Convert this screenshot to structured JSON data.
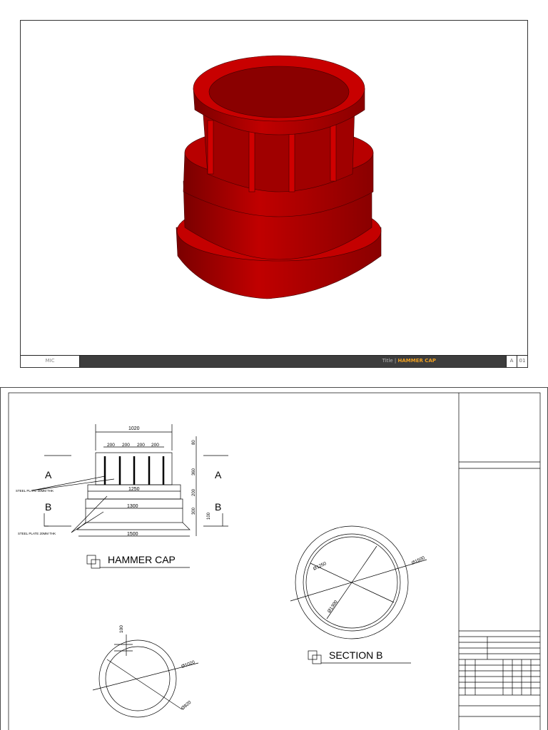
{
  "title_bar": {
    "left": "MIC",
    "title_label": "Title",
    "title": "HAMMER CAP",
    "rev": "A",
    "sheet": "01"
  },
  "elevation": {
    "dims_top": "1020",
    "dims_spacing": [
      "200",
      "200",
      "200",
      "200"
    ],
    "dim_1250": "1250",
    "dim_1300": "1300",
    "dim_1500": "1500",
    "dims_right": [
      "80",
      "360",
      "200",
      "300",
      "100"
    ],
    "section_a": "A",
    "section_b": "B",
    "note_30": "STEEL PLATE 30MM THK",
    "note_20": "STEEL PLATE 20MM THK",
    "caption": "HAMMER CAP"
  },
  "section_b": {
    "d1250": "Ø1250",
    "d1300": "Ø1300",
    "d1500": "Ø1500",
    "caption": "SECTION B"
  },
  "section_a": {
    "d100": "100",
    "d1020": "Ø1020",
    "d820": "Ø820"
  },
  "colors": {
    "body": "#b00000",
    "accent": "#f0a020"
  }
}
